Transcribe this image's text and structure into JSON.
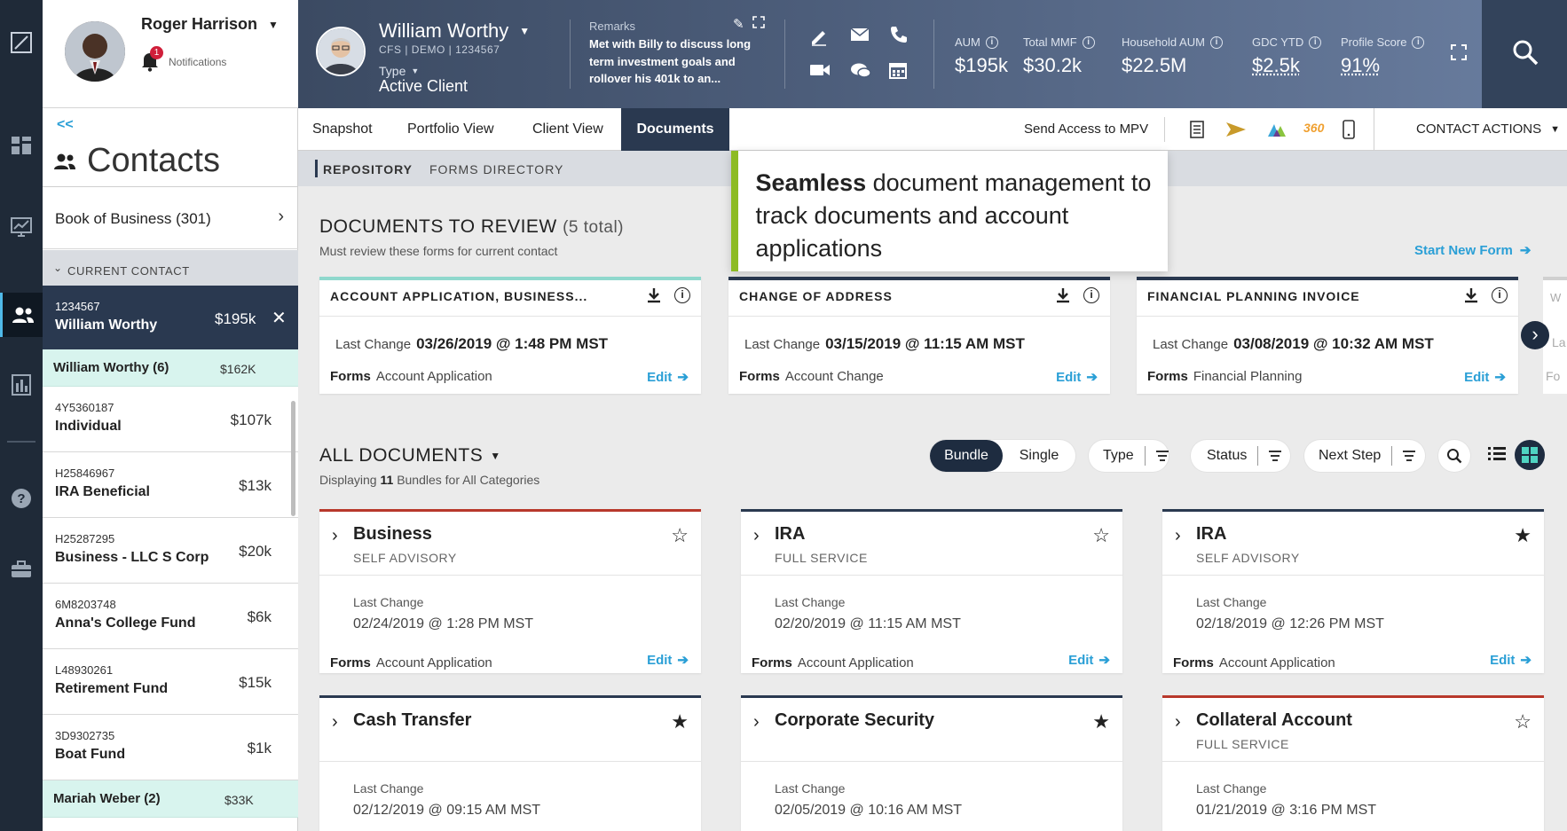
{
  "user": {
    "name": "Roger Harrison",
    "notifications_label": "Notifications",
    "notifications_count": "1"
  },
  "client": {
    "name": "William Worthy",
    "meta": "CFS | DEMO | 1234567",
    "type_label": "Type",
    "type_value": "Active Client",
    "remarks_label": "Remarks",
    "remarks_text": "Met with Billy to discuss long term investment goals and rollover his 401k to an..."
  },
  "metrics": [
    {
      "label": "AUM",
      "value": "$195k"
    },
    {
      "label": "Total MMF",
      "value": "$30.2k"
    },
    {
      "label": "Household AUM",
      "value": "$22.5M"
    },
    {
      "label": "GDC YTD",
      "value": "$2.5k"
    },
    {
      "label": "Profile Score",
      "value": "91%"
    }
  ],
  "sidebar": {
    "back": "<<",
    "title": "Contacts",
    "book_of_business": "Book of Business (301)",
    "current_contact_label": "CURRENT CONTACT",
    "current": {
      "id": "1234567",
      "name": "William Worthy",
      "amount": "$195k"
    },
    "group": {
      "name": "William Worthy (6)",
      "amount": "$162K"
    },
    "accounts": [
      {
        "number": "4Y5360187",
        "name": "Individual",
        "amount": "$107k"
      },
      {
        "number": "H25846967",
        "name": "IRA Beneficial",
        "amount": "$13k"
      },
      {
        "number": "H25287295",
        "name": "Business - LLC S Corp",
        "amount": "$20k"
      },
      {
        "number": "6M8203748",
        "name": "Anna's College Fund",
        "amount": "$6k"
      },
      {
        "number": "L48930261",
        "name": "Retirement Fund",
        "amount": "$15k"
      },
      {
        "number": "3D9302735",
        "name": "Boat Fund",
        "amount": "$1k"
      }
    ],
    "group2": {
      "name": "Mariah Weber (2)",
      "amount": "$33K"
    }
  },
  "tabs": [
    "Snapshot",
    "Portfolio View",
    "Client View",
    "Documents"
  ],
  "toolbar": {
    "send_access": "Send Access to MPV",
    "contact_actions": "CONTACT ACTIONS"
  },
  "subnav": [
    "REPOSITORY",
    "FORMS DIRECTORY"
  ],
  "tooltip": {
    "bold": "Seamless",
    "rest": " document management to track documents and account applications"
  },
  "review": {
    "title": "DOCUMENTS TO REVIEW",
    "count": "(5 total)",
    "subtitle": "Must review these forms for current contact",
    "start_new": "Start New Form",
    "last_change_label": "Last Change",
    "forms_label": "Forms",
    "edit_label": "Edit",
    "cards": [
      {
        "title": "ACCOUNT APPLICATION, BUSINESS...",
        "date": "03/26/2019 @ 1:48 PM MST",
        "form": "Account Application"
      },
      {
        "title": "CHANGE OF ADDRESS",
        "date": "03/15/2019 @ 11:15 AM MST",
        "form": "Account Change"
      },
      {
        "title": "FINANCIAL PLANNING INVOICE",
        "date": "03/08/2019 @ 10:32 AM MST",
        "form": "Financial Planning"
      }
    ],
    "peek": {
      "title": "W",
      "lc": "La",
      "forms": "Fo"
    }
  },
  "all_docs": {
    "title": "ALL DOCUMENTS",
    "displaying_prefix": "Displaying",
    "count": "11",
    "displaying_suffix": "Bundles for All Categories",
    "toggle": [
      "Bundle",
      "Single"
    ],
    "filters": [
      "Type",
      "Status",
      "Next Step"
    ],
    "last_change_label": "Last Change",
    "forms_label": "Forms",
    "edit_label": "Edit",
    "bundles": [
      {
        "name": "Business",
        "sub": "SELF ADVISORY",
        "date": "02/24/2019 @ 1:28 PM MST",
        "form": "Account Application",
        "starred": false,
        "accent": "#b8382b"
      },
      {
        "name": "IRA",
        "sub": "FULL SERVICE",
        "date": "02/20/2019 @ 11:15 AM MST",
        "form": "Account Application",
        "starred": false,
        "accent": "#2a3950"
      },
      {
        "name": "IRA",
        "sub": "SELF ADVISORY",
        "date": "02/18/2019 @ 12:26 PM MST",
        "form": "Account Application",
        "starred": true,
        "accent": "#2a3950"
      },
      {
        "name": "Cash Transfer",
        "sub": "",
        "date": "02/12/2019 @ 09:15 AM MST",
        "form": "",
        "starred": true,
        "accent": "#2a3950"
      },
      {
        "name": "Corporate Security",
        "sub": "",
        "date": "02/05/2019 @ 10:16 AM MST",
        "form": "",
        "starred": true,
        "accent": "#2a3950"
      },
      {
        "name": "Collateral Account",
        "sub": "FULL SERVICE",
        "date": "01/21/2019 @ 3:16 PM MST",
        "form": "",
        "starred": false,
        "accent": "#b8382b"
      }
    ]
  }
}
